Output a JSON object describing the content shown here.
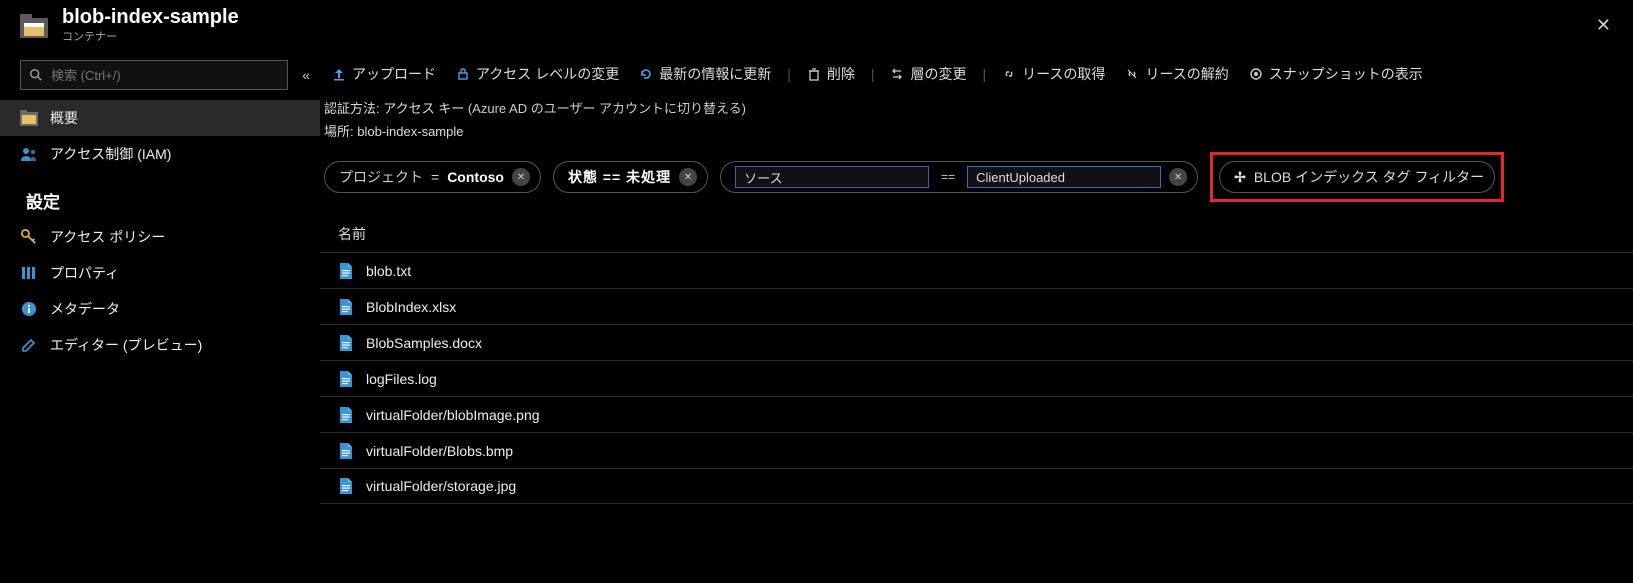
{
  "header": {
    "title": "blob-index-sample",
    "subtitle": "コンテナー"
  },
  "sidebar": {
    "search_placeholder": "検索 (Ctrl+/)",
    "nav": [
      {
        "id": "overview",
        "label": "概要",
        "active": true
      },
      {
        "id": "iam",
        "label": "アクセス制御 (IAM)"
      }
    ],
    "settings_heading": "設定",
    "settings": [
      {
        "id": "access-policy",
        "label": "アクセス ポリシー"
      },
      {
        "id": "properties",
        "label": "プロパティ"
      },
      {
        "id": "metadata",
        "label": "メタデータ"
      },
      {
        "id": "editor",
        "label": "エディター (プレビュー)"
      }
    ]
  },
  "toolbar": {
    "upload": "アップロード",
    "change_access": "アクセス レベルの変更",
    "refresh": "最新の情報に更新",
    "delete": "削除",
    "change_tier": "層の変更",
    "acquire_lease": "リースの取得",
    "break_lease": "リースの解約",
    "show_snapshots": "スナップショットの表示"
  },
  "info": {
    "auth_label": "認証方法:",
    "auth_value": "アクセス キー",
    "auth_switch": "(Azure AD のユーザー アカウントに切り替える)",
    "location_label": "場所:",
    "location_value": "blob-index-sample"
  },
  "filters": {
    "project_key": "プロジェクト",
    "project_op": "=",
    "project_val": "Contoso",
    "state_text": "状態 == 未処理",
    "source_key": "ソース",
    "source_op": "==",
    "source_val": "ClientUploaded",
    "add_filter_label": "BLOB インデックス タグ フィルター"
  },
  "list": {
    "name_header": "名前",
    "items": [
      "blob.txt",
      "BlobIndex.xlsx",
      "BlobSamples.docx",
      "logFiles.log",
      "virtualFolder/blobImage.png",
      "virtualFolder/Blobs.bmp",
      "virtualFolder/storage.jpg"
    ]
  }
}
